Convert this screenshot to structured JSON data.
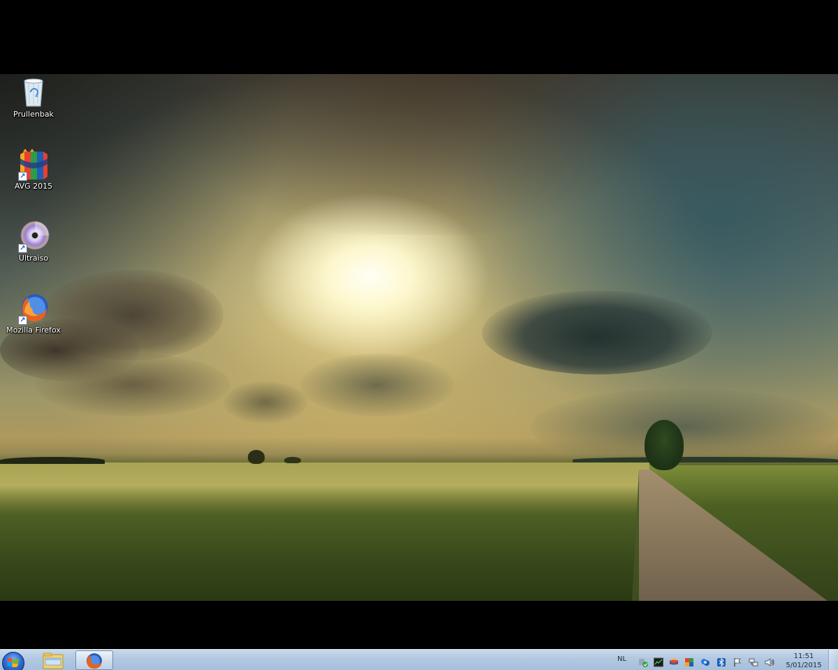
{
  "desktop": {
    "icons": [
      {
        "label": "Prullenbak",
        "icon": "recycle-bin-icon"
      },
      {
        "label": "AVG 2015",
        "icon": "avg-icon"
      },
      {
        "label": "Ultraiso",
        "icon": "disc-icon"
      },
      {
        "label": "Mozilla Firefox",
        "icon": "firefox-icon"
      }
    ]
  },
  "taskbar": {
    "start_icon": "windows-start-icon",
    "pinned": [
      {
        "icon": "file-explorer-icon"
      },
      {
        "icon": "firefox-icon",
        "active": true
      }
    ],
    "language": "NL",
    "tray_icons": [
      "update-icon",
      "monitor-icon",
      "avg-tray-icon",
      "color-squares-icon",
      "messenger-icon",
      "bluetooth-icon",
      "flag-icon",
      "network-icon",
      "volume-icon"
    ],
    "clock": {
      "time": "11:51",
      "date": "5/01/2015"
    }
  },
  "colors": {
    "taskbar": "#b2c8e0",
    "background": "#000000"
  }
}
